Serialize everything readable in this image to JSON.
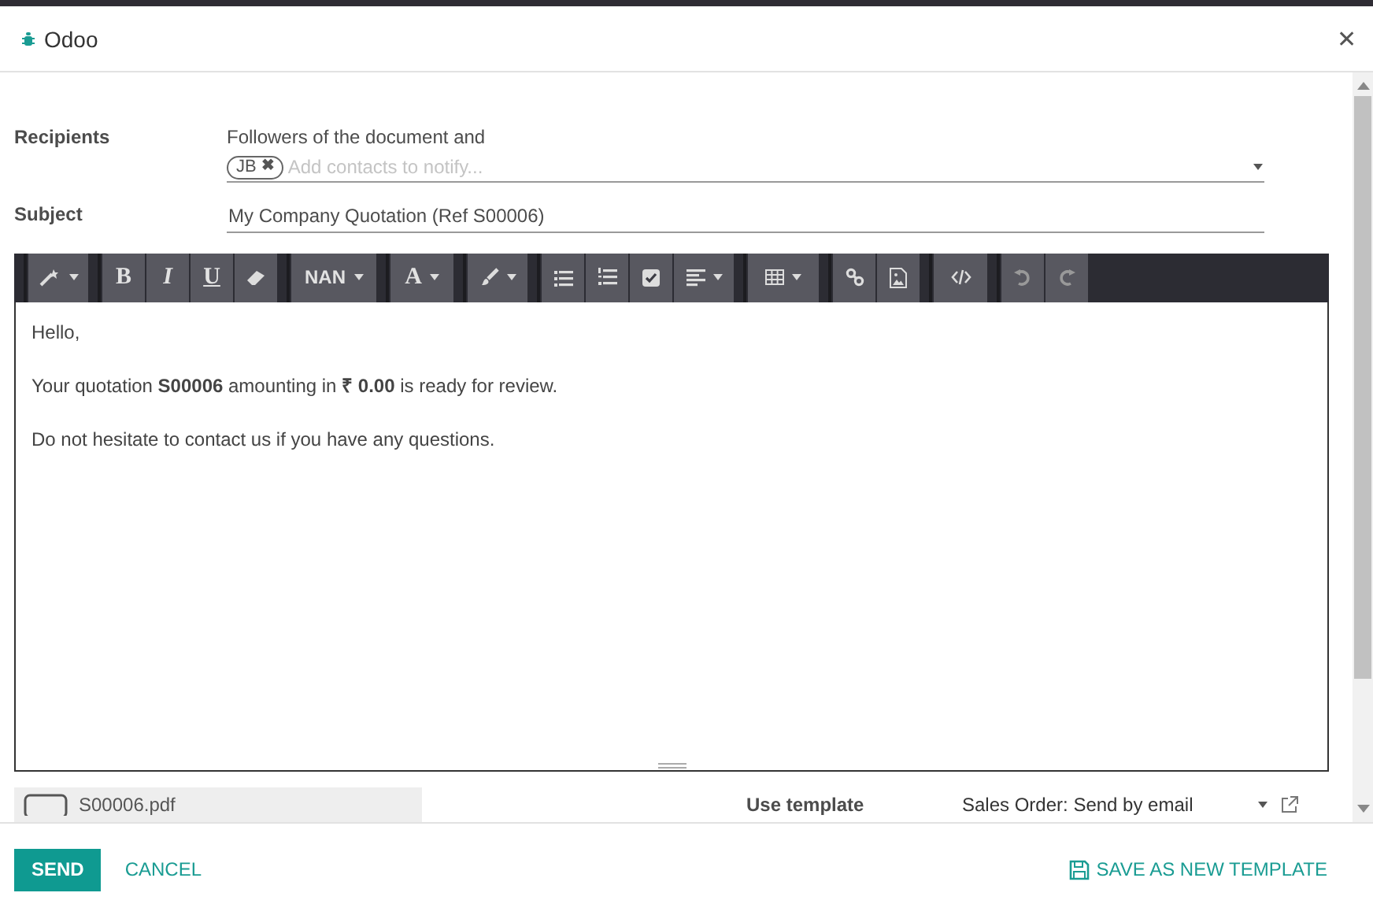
{
  "window": {
    "title": "Odoo",
    "close": "✕"
  },
  "recipients": {
    "label": "Recipients",
    "note": "Followers of the document and",
    "tags": [
      {
        "label": "JB",
        "remove": "✖"
      }
    ],
    "placeholder": "Add contacts to notify..."
  },
  "subject": {
    "label": "Subject",
    "value": "My Company Quotation (Ref S00006)"
  },
  "toolbar": {
    "bold": "B",
    "italic": "I",
    "underline": "U",
    "style_label": "NAN",
    "color_label": "A"
  },
  "body": [
    "Hello,",
    "Your quotation **S00006** amounting in **₹ 0.00** is ready for review.",
    "Do not hesitate to contact us if you have any questions."
  ],
  "attachments": [
    "S00006.pdf"
  ],
  "template": {
    "label": "Use template",
    "value": "Sales Order: Send by email"
  },
  "buttons": {
    "send": "SEND",
    "cancel": "CANCEL",
    "save_template": "SAVE AS NEW TEMPLATE"
  }
}
